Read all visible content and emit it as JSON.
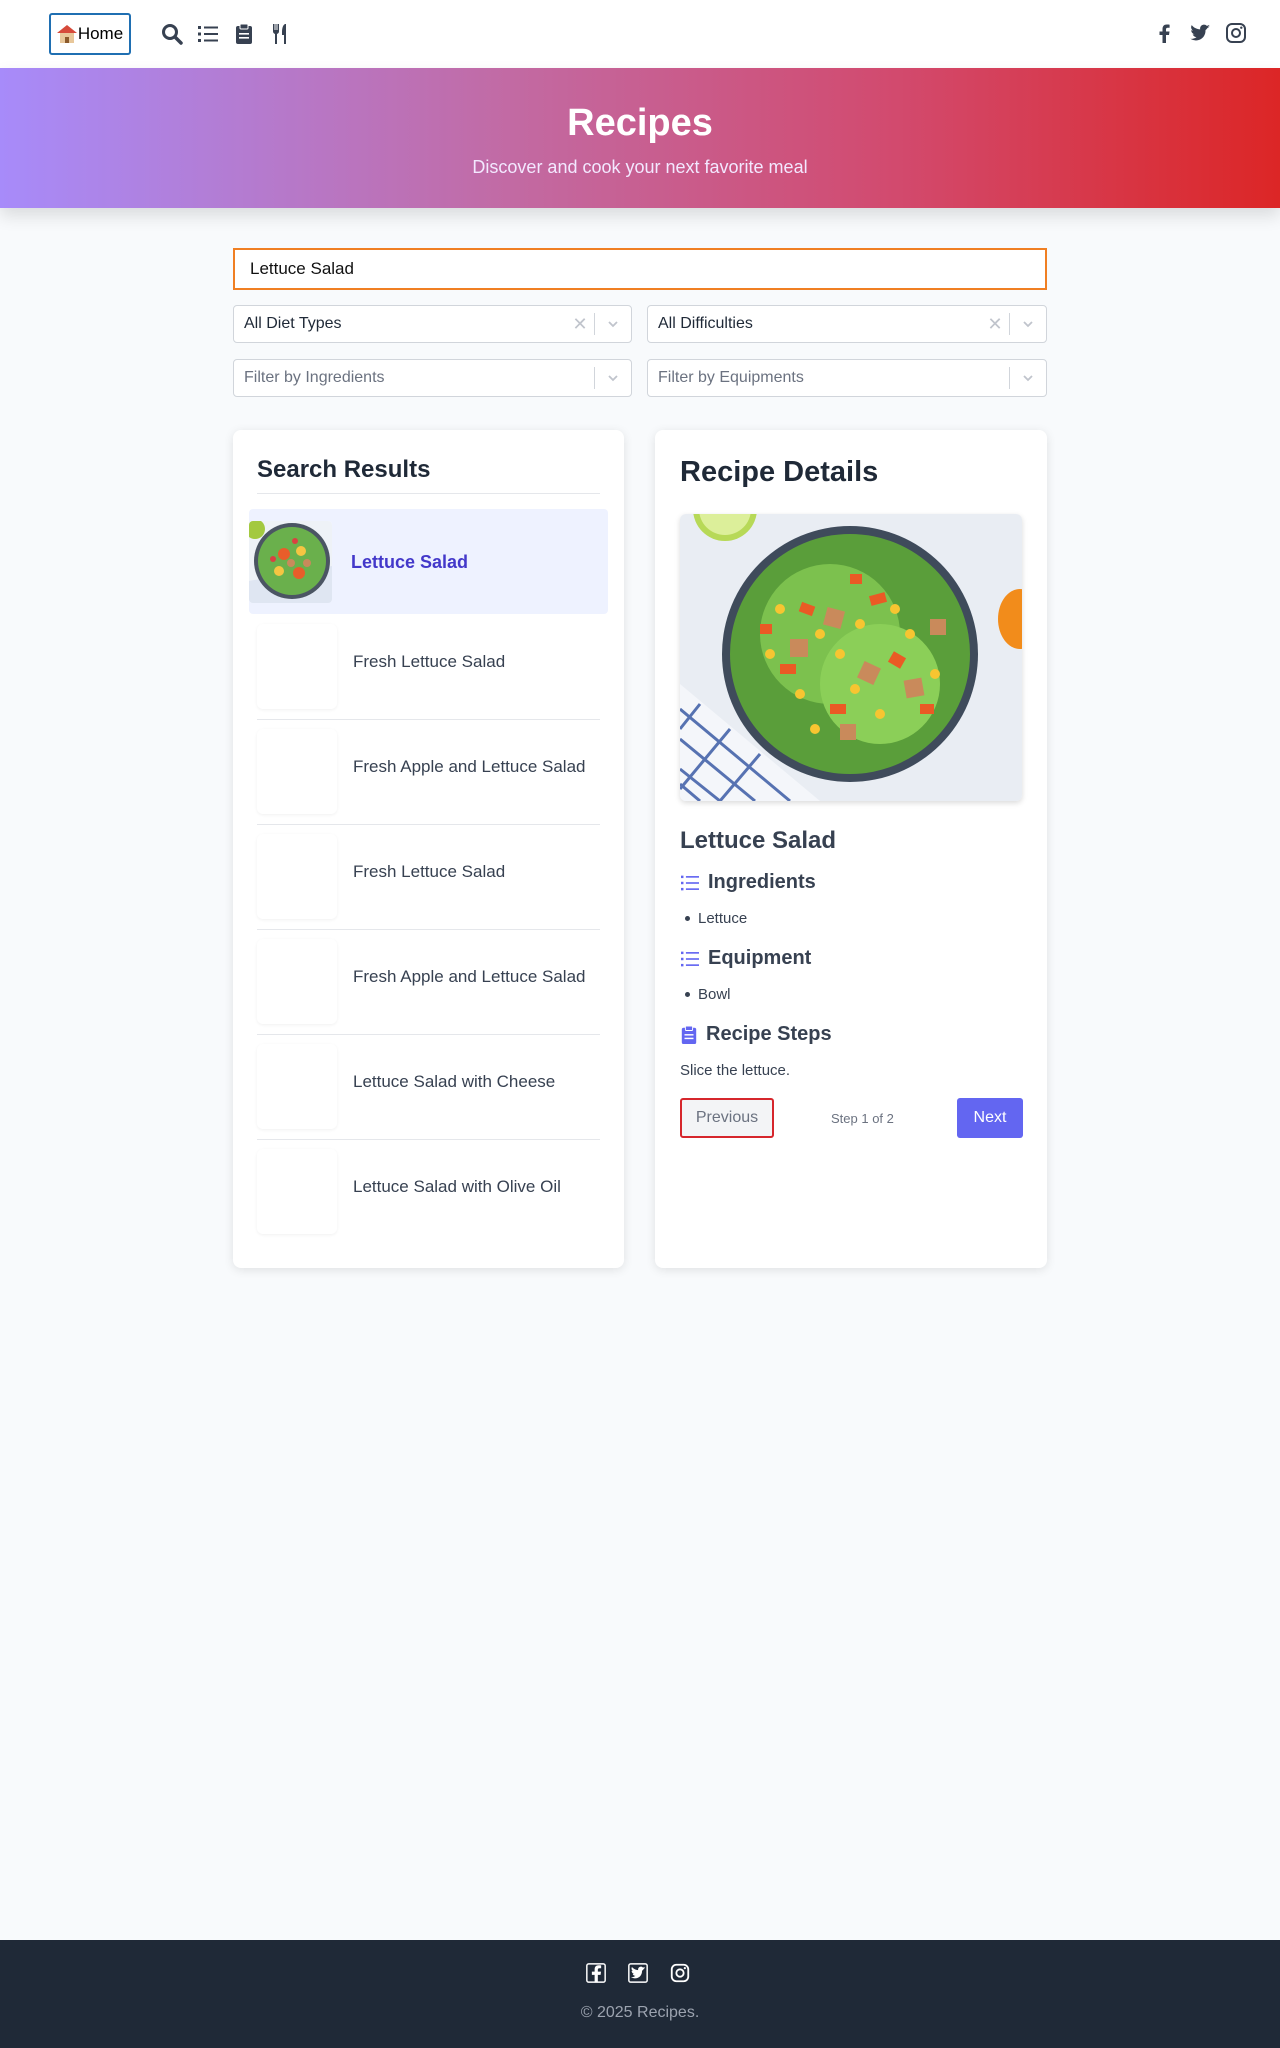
{
  "nav": {
    "home_label": "Home",
    "icons": [
      "search-icon",
      "list-icon",
      "clipboard-icon",
      "utensils-icon"
    ],
    "social": [
      "facebook-icon",
      "twitter-icon",
      "instagram-icon"
    ]
  },
  "hero": {
    "title": "Recipes",
    "subtitle": "Discover and cook your next favorite meal"
  },
  "search": {
    "value": "Lettuce Salad"
  },
  "filters": {
    "diet": "All Diet Types",
    "difficulty": "All Difficulties",
    "ingredients_placeholder": "Filter by Ingredients",
    "equipment_placeholder": "Filter by Equipments"
  },
  "results": {
    "title": "Search Results",
    "items": [
      {
        "name": "Lettuce Salad",
        "selected": true
      },
      {
        "name": "Fresh Lettuce Salad",
        "selected": false
      },
      {
        "name": "Fresh Apple and Lettuce Salad",
        "selected": false
      },
      {
        "name": "Fresh Lettuce Salad",
        "selected": false
      },
      {
        "name": "Fresh Apple and Lettuce Salad",
        "selected": false
      },
      {
        "name": "Lettuce Salad with Cheese",
        "selected": false
      },
      {
        "name": "Lettuce Salad with Olive Oil",
        "selected": false
      }
    ]
  },
  "details": {
    "title": "Recipe Details",
    "recipe_name": "Lettuce Salad",
    "ingredients_heading": "Ingredients",
    "ingredients": [
      "Lettuce"
    ],
    "equipment_heading": "Equipment",
    "equipment": [
      "Bowl"
    ],
    "steps_heading": "Recipe Steps",
    "step_text": "Slice the lettuce.",
    "previous_label": "Previous",
    "step_counter": "Step 1 of 2",
    "next_label": "Next"
  },
  "footer": {
    "copyright": "© 2025 Recipes."
  },
  "colors": {
    "accent": "#6366f1",
    "selected_text": "#4338ca",
    "hero_gradient_start": "#a78bfa",
    "hero_gradient_end": "#dc2626",
    "footer_bg": "#1f2937"
  }
}
